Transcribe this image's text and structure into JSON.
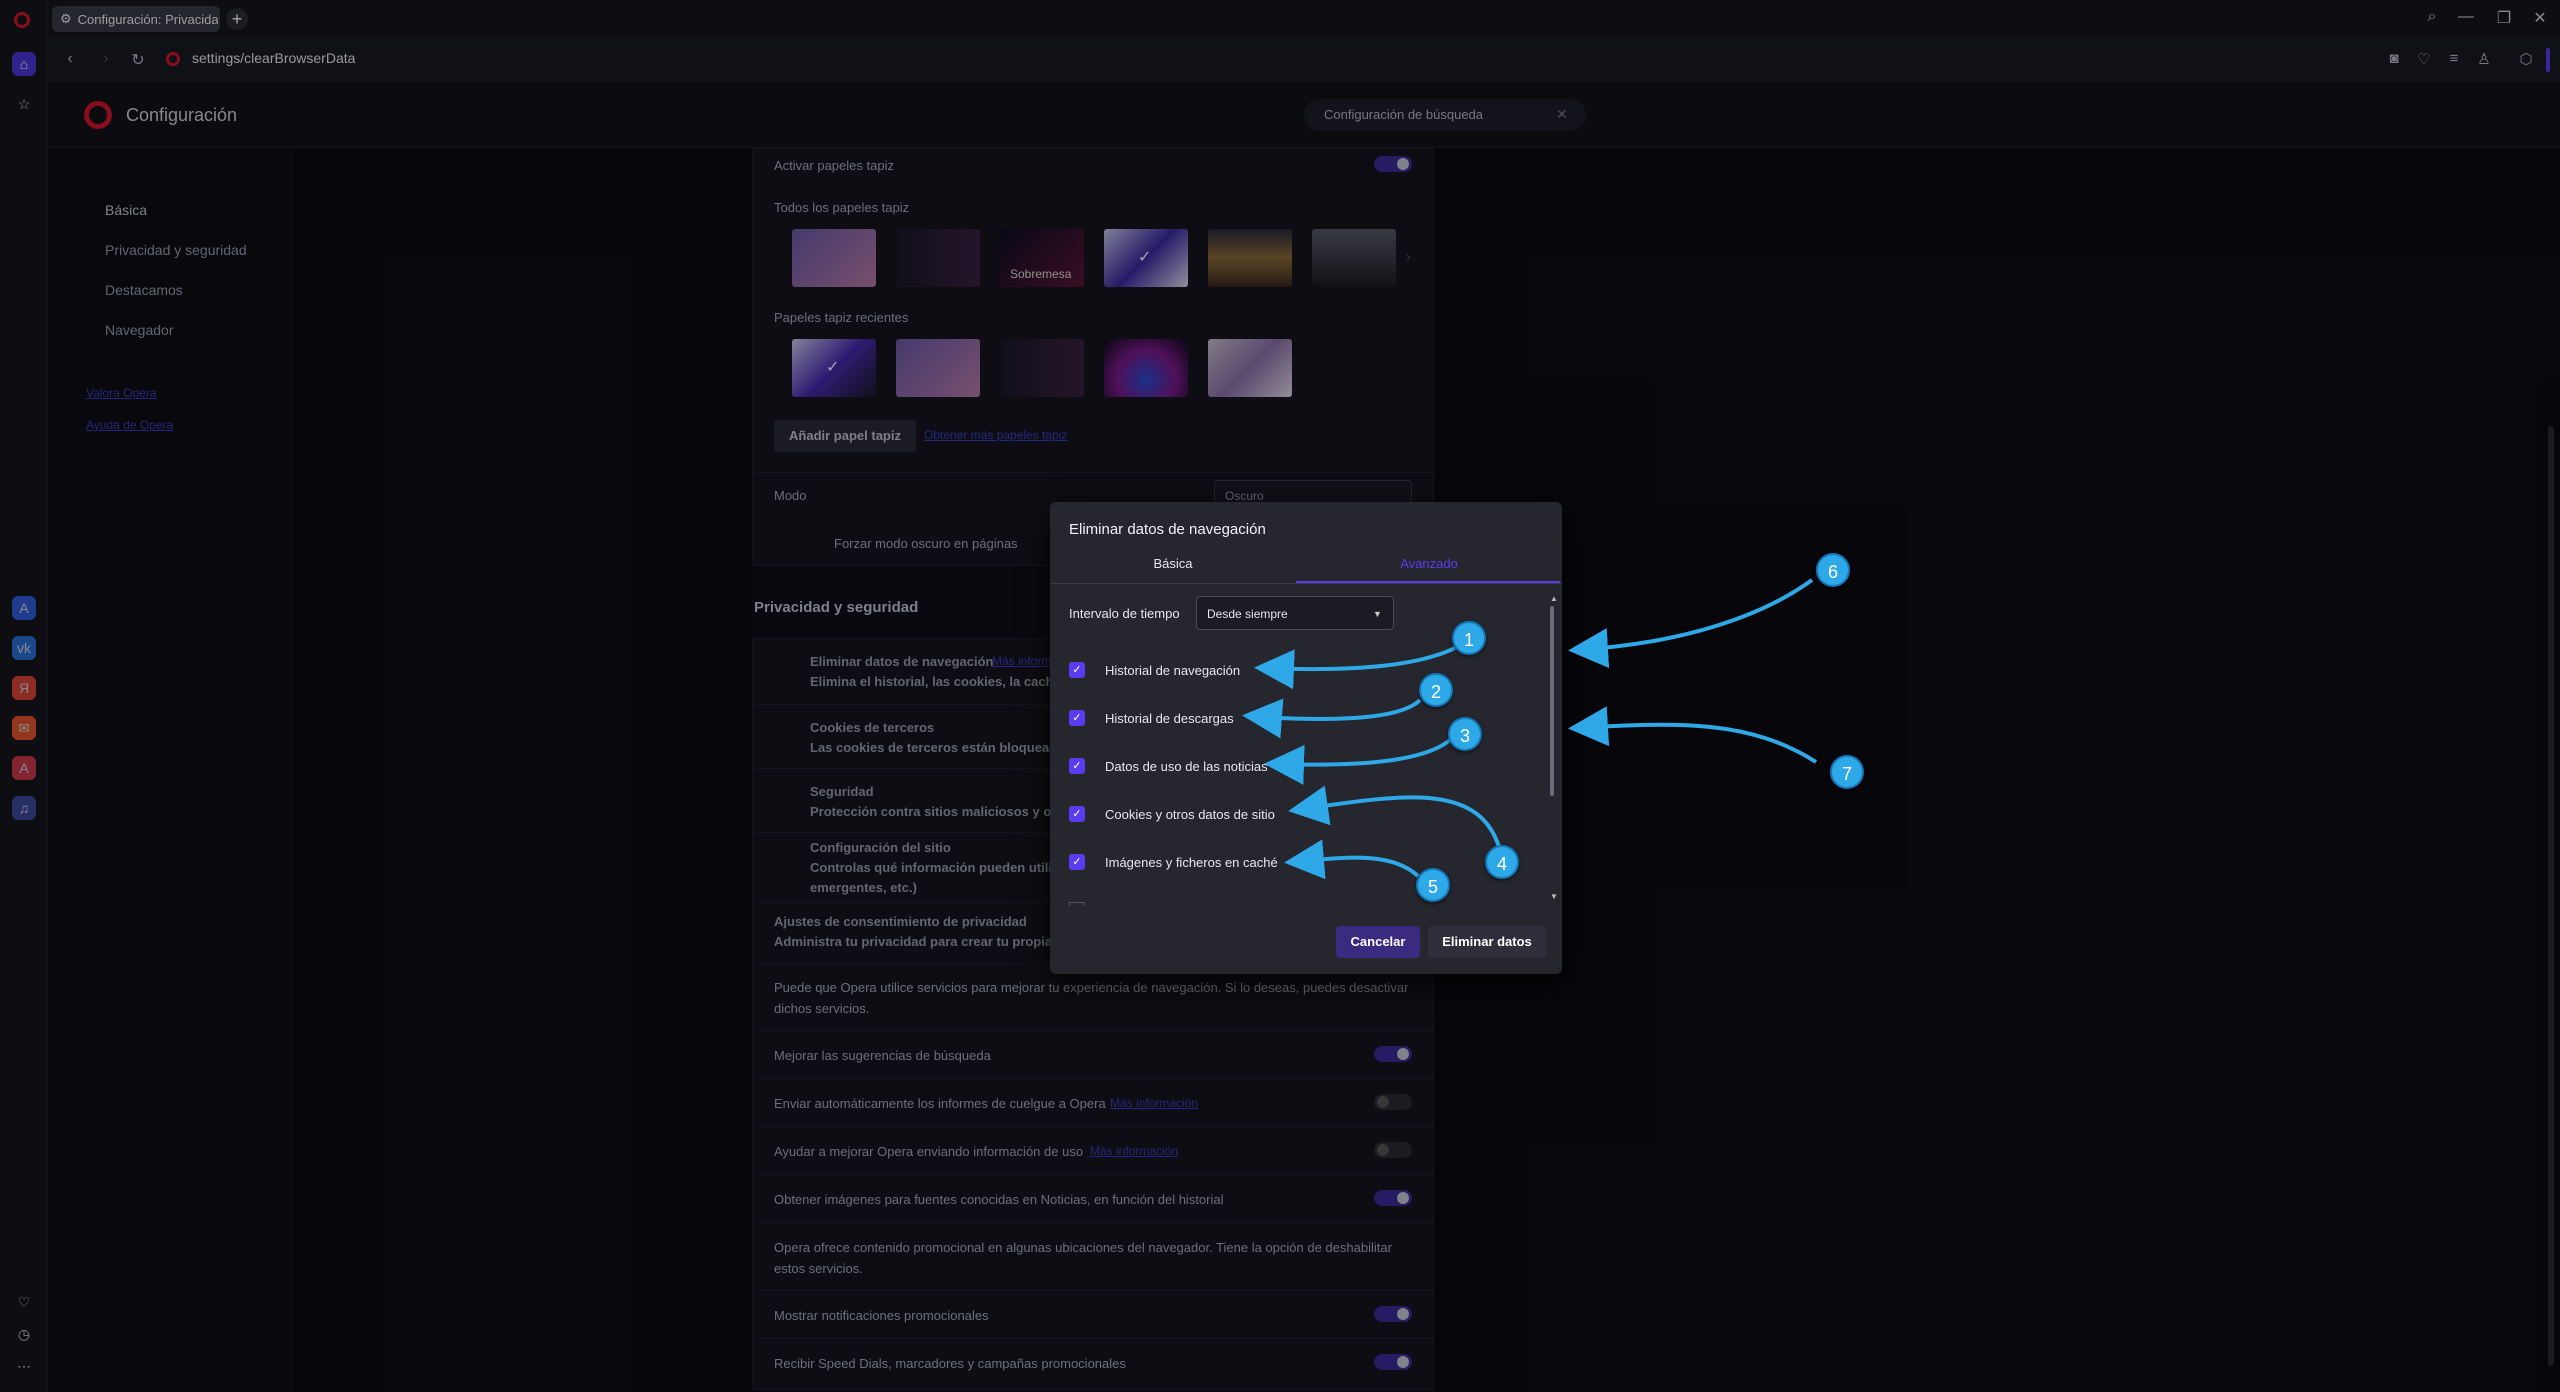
{
  "browser": {
    "tab_title": "Configuración: Privacidad",
    "url": "settings/clearBrowserData"
  },
  "settings": {
    "title": "Configuración",
    "search_placeholder": "Configuración de búsqueda",
    "nav": [
      "Básica",
      "Privacidad y seguridad",
      "Destacamos",
      "Navegador"
    ],
    "links": [
      "Valora Opera",
      "Ayuda de Opera"
    ]
  },
  "appearance": {
    "wallpapers_toggle": "Activar papeles tapiz",
    "all_wallpapers": "Todos los papeles tapiz",
    "desktop_label": "Sobremesa",
    "recent_wallpapers": "Papeles tapiz recientes",
    "add_wallpaper": "Añadir papel tapiz",
    "get_more": "Obtener más papeles tapiz",
    "mode_label": "Modo",
    "mode_value": "Oscuro",
    "force_dark": "Forzar modo oscuro en páginas"
  },
  "privacy": {
    "section_title": "Privacidad y seguridad",
    "items": [
      {
        "title": "Eliminar datos de navegación",
        "link": "Más inform",
        "desc": "Elimina el historial, las cookies, la caché y"
      },
      {
        "title": "Cookies de terceros",
        "desc": "Las cookies de terceros están bloqueadas"
      },
      {
        "title": "Seguridad",
        "desc": "Protección contra sitios maliciosos y otr"
      },
      {
        "title": "Configuración del sitio",
        "desc": "Controlas qué información pueden utiliza",
        "desc2": "emergentes, etc.)"
      }
    ],
    "consent_title": "Ajustes de consentimiento de privacidad",
    "consent_desc": "Administra tu privacidad para crear tu propia e",
    "services_text_1": "Puede que Opera utilice servicios para mejorar tu experiencia de navegación. Si lo deseas, puedes desactivar",
    "services_text_2": "dichos servicios.",
    "toggles": [
      {
        "label": "Mejorar las sugerencias de búsqueda",
        "link": "",
        "on": true
      },
      {
        "label": "Enviar automáticamente los informes de cuelgue a Opera",
        "link": "Más información",
        "on": false
      },
      {
        "label": "Ayudar a mejorar Opera enviando información de uso",
        "link": "Más información",
        "on": false
      },
      {
        "label": "Obtener imágenes para fuentes conocidas en Noticias, en función del historial",
        "link": "",
        "on": true
      }
    ],
    "promo_text_1": "Opera ofrece contenido promocional en algunas ubicaciones del navegador. Tiene la opción de deshabilitar",
    "promo_text_2": "estos servicios.",
    "promo_toggles": [
      {
        "label": "Mostrar notificaciones promocionales",
        "on": true
      },
      {
        "label": "Recibir Speed Dials, marcadores y campañas promocionales",
        "on": true
      }
    ]
  },
  "dialog": {
    "title": "Eliminar datos de navegación",
    "tabs": [
      "Básica",
      "Avanzado"
    ],
    "active_tab": "Avanzado",
    "time_range_label": "Intervalo de tiempo",
    "time_range_value": "Desde siempre",
    "checkboxes": [
      {
        "label": "Historial de navegación",
        "checked": true
      },
      {
        "label": "Historial de descargas",
        "checked": true
      },
      {
        "label": "Datos de uso de las noticias",
        "checked": true
      },
      {
        "label": "Cookies y otros datos de sitio",
        "checked": true
      },
      {
        "label": "Imágenes y ficheros en caché",
        "checked": true
      }
    ],
    "cancel": "Cancelar",
    "confirm": "Eliminar datos"
  },
  "annotations": [
    "1",
    "2",
    "3",
    "4",
    "5",
    "6",
    "7"
  ],
  "colors": {
    "accent": "#5b3bf0",
    "annotation": "#2fa8e8",
    "opera_red": "#d0162b"
  }
}
